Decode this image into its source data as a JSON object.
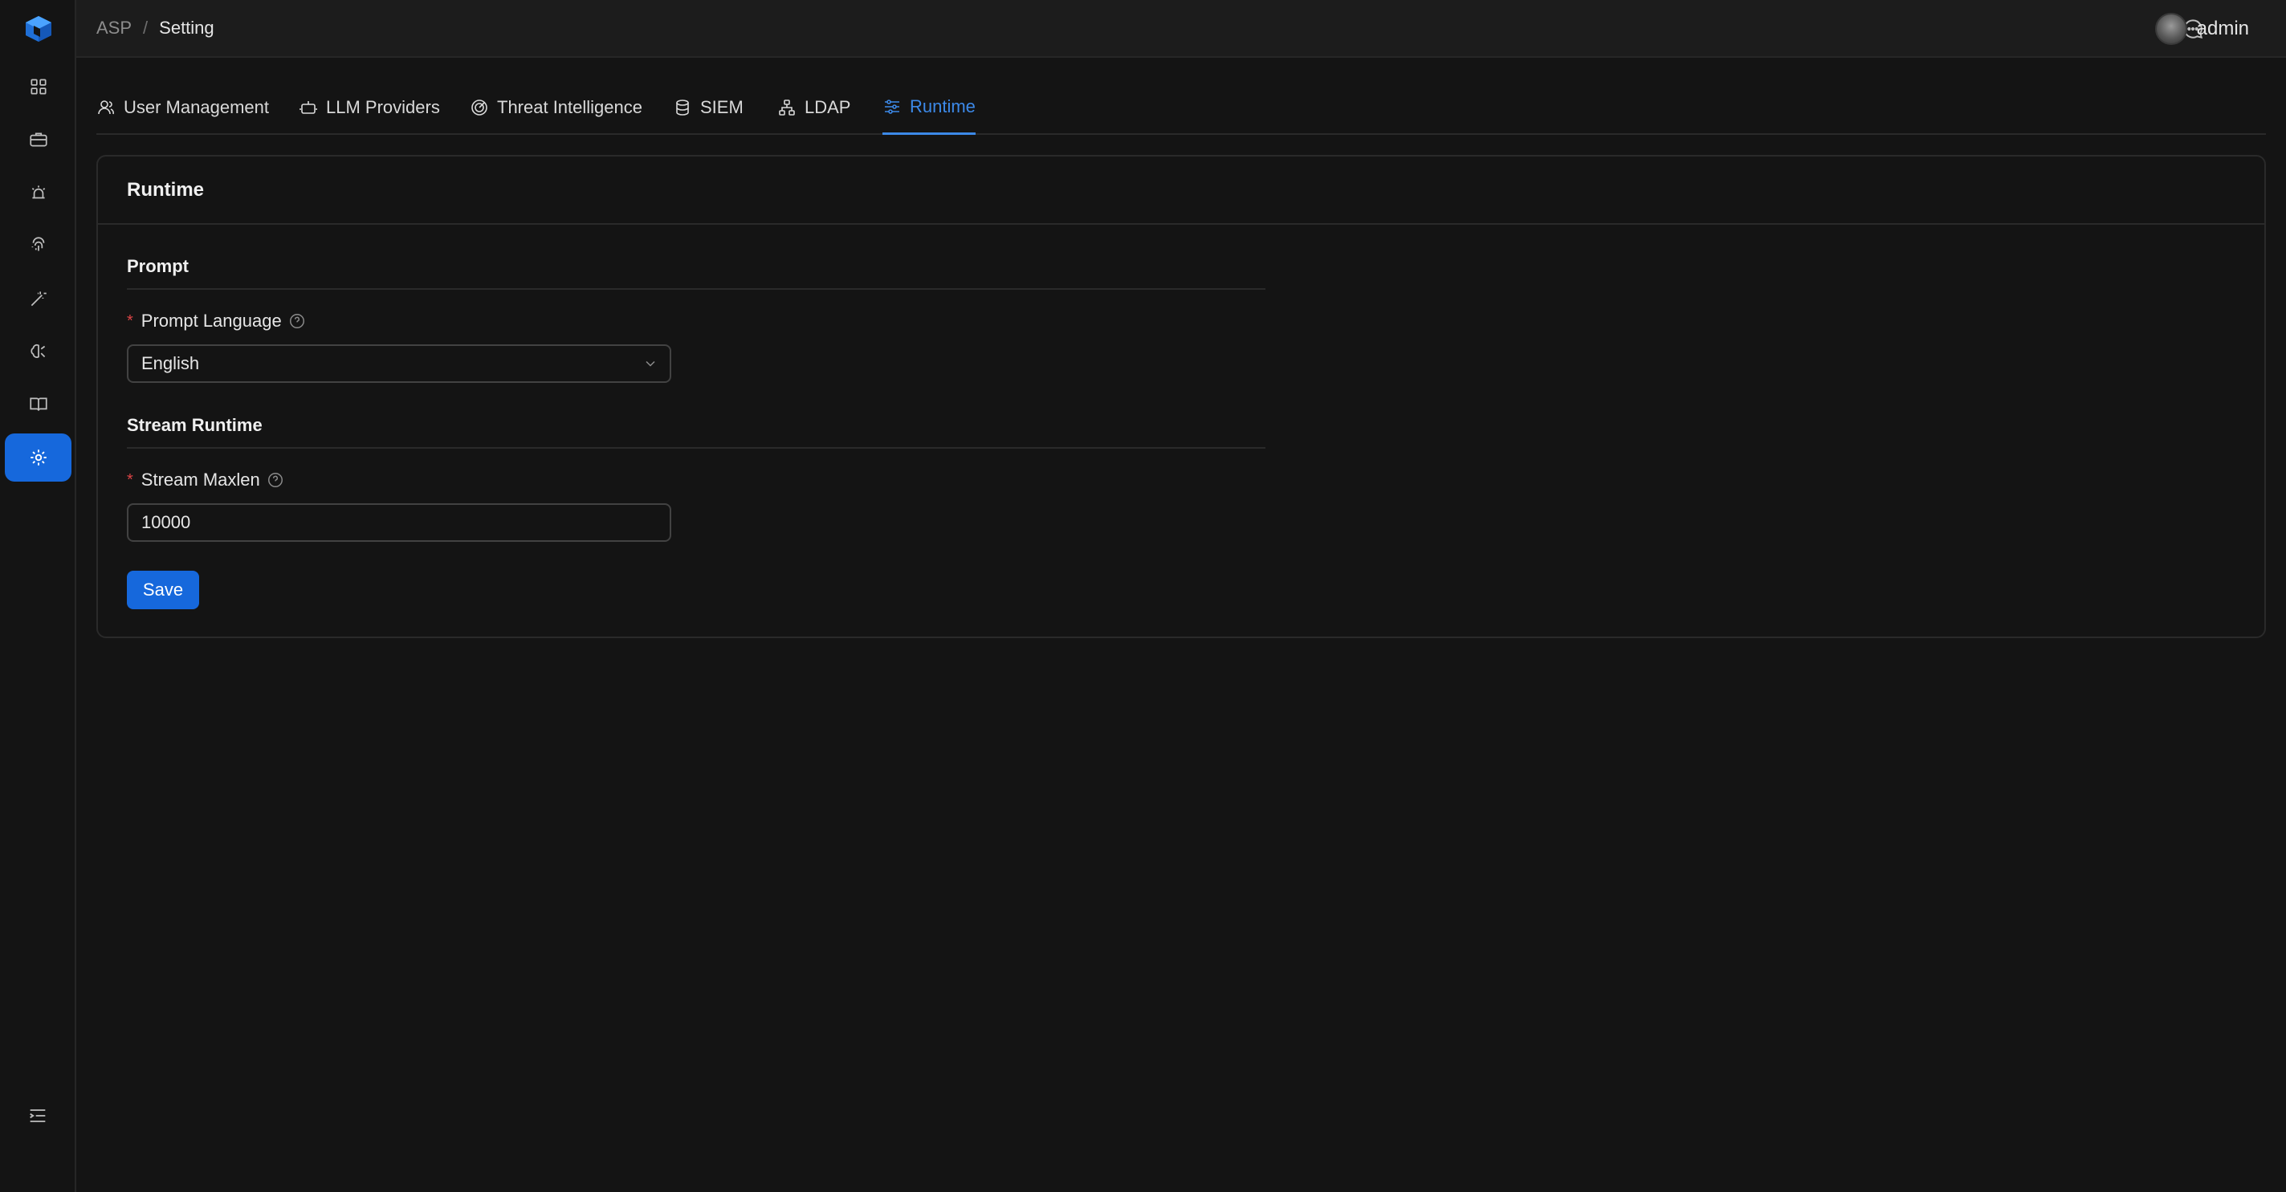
{
  "app": {
    "accent_color": "#1668dc",
    "logo_icon": "hexagon-logo-icon"
  },
  "sidebar": {
    "items": [
      {
        "icon": "dashboard-grid-icon",
        "active": false
      },
      {
        "icon": "briefcase-icon",
        "active": false
      },
      {
        "icon": "alarm-siren-icon",
        "active": false
      },
      {
        "icon": "fingerprint-icon",
        "active": false
      },
      {
        "icon": "magic-wand-icon",
        "active": false
      },
      {
        "icon": "brain-icon",
        "active": false
      },
      {
        "icon": "book-icon",
        "active": false
      },
      {
        "icon": "gear-icon",
        "active": true
      }
    ],
    "collapse_icon": "menu-collapse-icon"
  },
  "header": {
    "breadcrumb": [
      "ASP",
      "Setting"
    ],
    "separator": "/",
    "chat_icon": "message-icon",
    "user_name": "admin"
  },
  "tabs": [
    {
      "label": "User Management",
      "icon": "user-icon",
      "active": false
    },
    {
      "label": "LLM Providers",
      "icon": "robot-icon",
      "active": false
    },
    {
      "label": "Threat Intelligence",
      "icon": "radar-icon",
      "active": false
    },
    {
      "label": "SIEM",
      "icon": "database-icon",
      "active": false
    },
    {
      "label": "LDAP",
      "icon": "cluster-icon",
      "active": false
    },
    {
      "label": "Runtime",
      "icon": "sliders-icon",
      "active": true
    }
  ],
  "card": {
    "title": "Runtime",
    "sections": [
      {
        "title": "Prompt",
        "field": {
          "label": "Prompt Language",
          "required": true,
          "type": "select",
          "value": "English"
        }
      },
      {
        "title": "Stream Runtime",
        "field": {
          "label": "Stream Maxlen",
          "required": true,
          "type": "input",
          "value": "10000"
        }
      }
    ],
    "save_label": "Save"
  }
}
